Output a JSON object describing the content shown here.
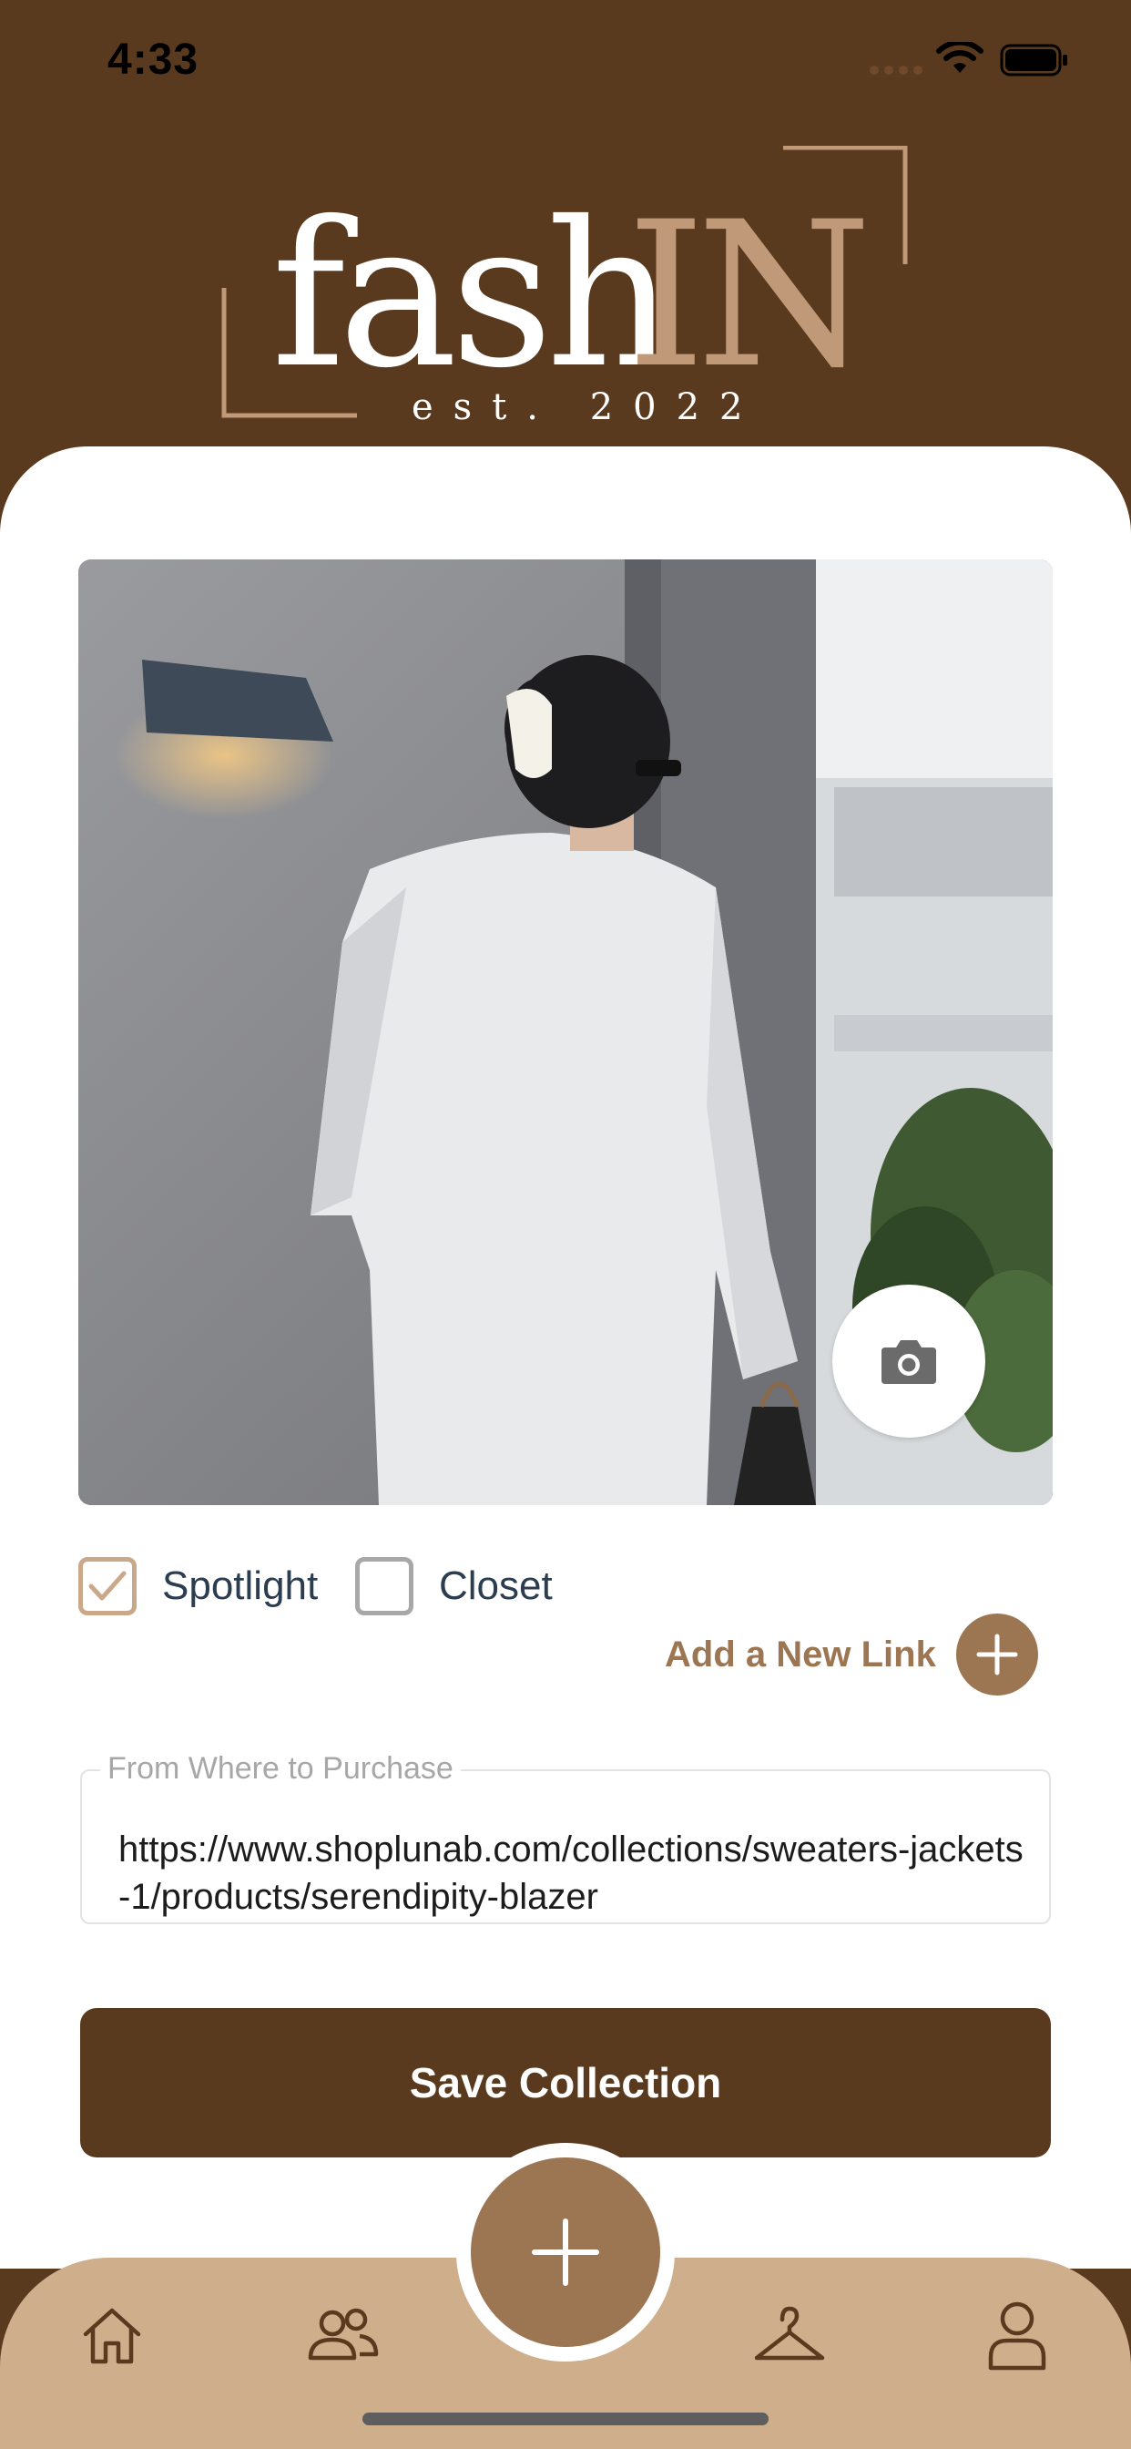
{
  "status_bar": {
    "time": "4:33"
  },
  "logo": {
    "word_plain": "fash",
    "word_accent": "IN",
    "tagline": "est. 2022"
  },
  "photo": {
    "alt": "photo"
  },
  "options": {
    "spotlight": {
      "label": "Spotlight",
      "checked": true
    },
    "closet": {
      "label": "Closet",
      "checked": false
    }
  },
  "add_link": {
    "label": "Add a New Link"
  },
  "purchase_field": {
    "label": "From Where to Purchase",
    "value": "https://www.shoplunab.com/collections/sweaters-jackets-1/products/serendipity-blazer"
  },
  "save_button": {
    "label": "Save Collection"
  },
  "tabbar": {
    "items": [
      {
        "icon": "home-icon"
      },
      {
        "icon": "people-icon"
      },
      {
        "icon": "plus-icon"
      },
      {
        "icon": "hanger-icon"
      },
      {
        "icon": "profile-icon"
      }
    ]
  },
  "colors": {
    "brand_dark": "#5a3a1e",
    "brand_accent": "#9c7652",
    "tabbar": "#cfae8c",
    "logo_accent": "#c09a78"
  }
}
